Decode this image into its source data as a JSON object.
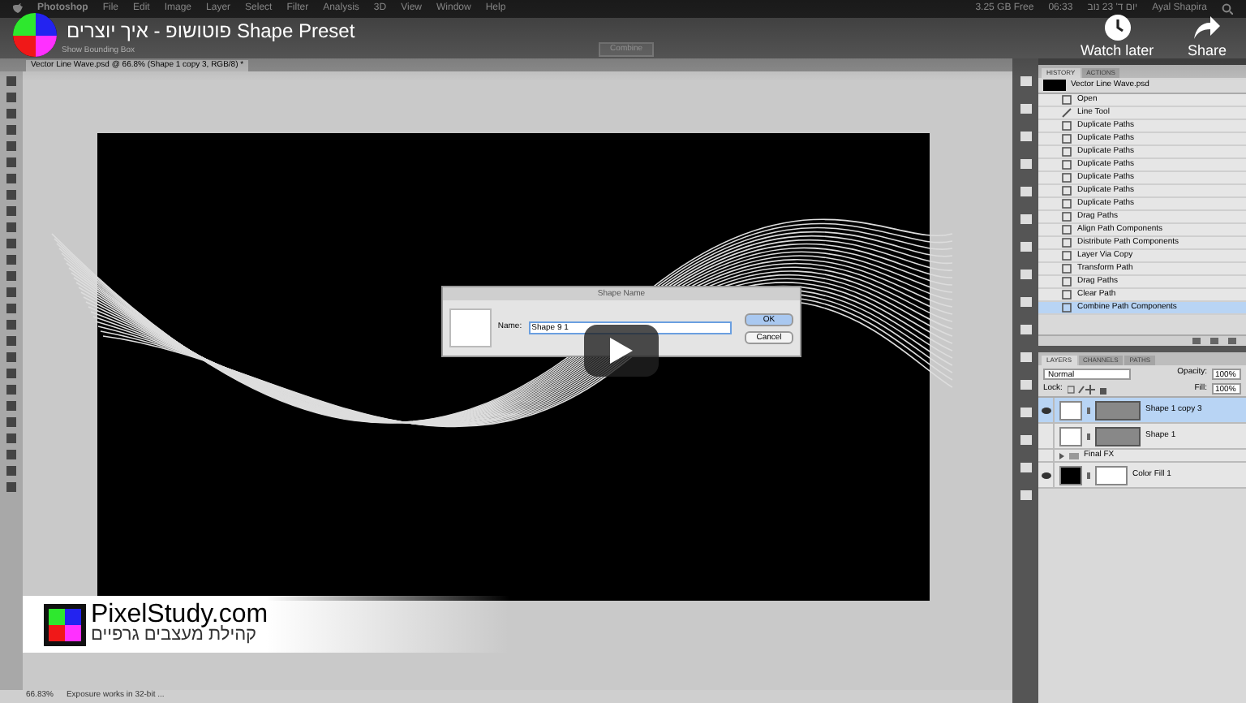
{
  "player": {
    "title": "פוטושופ - איך יוצרים Shape Preset",
    "watch_later_label": "Watch later",
    "share_label": "Share"
  },
  "menu_bar": {
    "app": "Photoshop",
    "items": [
      "File",
      "Edit",
      "Image",
      "Layer",
      "Select",
      "Filter",
      "Analysis",
      "3D",
      "View",
      "Window",
      "Help"
    ],
    "status": [
      "3.25 GB Free",
      "06:33",
      "יום ד' 23 נוב",
      "Ayal Shapira"
    ]
  },
  "options_bar": {
    "items": [
      "Show Bounding Box",
      "Combine"
    ]
  },
  "document_tab": {
    "title": "Vector Line Wave.psd @ 66.8% (Shape 1 copy 3, RGB/8) *"
  },
  "dialog": {
    "title": "Shape Name",
    "name_label": "Name:",
    "name_value": "Shape 9 1",
    "buttons": [
      {
        "label": "OK",
        "default": true
      },
      {
        "label": "Cancel",
        "default": false
      }
    ]
  },
  "history": {
    "tabs": [
      {
        "label": "HISTORY",
        "selected": true
      },
      {
        "label": "ACTIONS",
        "selected": false
      }
    ],
    "snapshot": "Vector Line Wave.psd",
    "items": [
      {
        "label": "Open",
        "kind": "document",
        "selected": false
      },
      {
        "label": "Line Tool",
        "kind": "line",
        "selected": false
      },
      {
        "label": "Duplicate Paths",
        "kind": "document",
        "selected": false
      },
      {
        "label": "Duplicate Paths",
        "kind": "document",
        "selected": false
      },
      {
        "label": "Duplicate Paths",
        "kind": "document",
        "selected": false
      },
      {
        "label": "Duplicate Paths",
        "kind": "document",
        "selected": false
      },
      {
        "label": "Duplicate Paths",
        "kind": "document",
        "selected": false
      },
      {
        "label": "Duplicate Paths",
        "kind": "document",
        "selected": false
      },
      {
        "label": "Duplicate Paths",
        "kind": "document",
        "selected": false
      },
      {
        "label": "Drag Paths",
        "kind": "document",
        "selected": false
      },
      {
        "label": "Align Path Components",
        "kind": "document",
        "selected": false
      },
      {
        "label": "Distribute Path Components",
        "kind": "document",
        "selected": false
      },
      {
        "label": "Layer Via Copy",
        "kind": "document",
        "selected": false
      },
      {
        "label": "Transform Path",
        "kind": "document",
        "selected": false
      },
      {
        "label": "Drag Paths",
        "kind": "document",
        "selected": false
      },
      {
        "label": "Clear Path",
        "kind": "document",
        "selected": false
      },
      {
        "label": "Combine Path Components",
        "kind": "document",
        "selected": true
      }
    ]
  },
  "layers": {
    "tabs": [
      {
        "label": "LAYERS",
        "selected": true
      },
      {
        "label": "CHANNELS",
        "selected": false
      },
      {
        "label": "PATHS",
        "selected": false
      }
    ],
    "blend_mode": "Normal",
    "opacity_label": "Opacity:",
    "opacity": "100%",
    "lock_label": "Lock:",
    "fill_label": "Fill:",
    "fill": "100%",
    "layers": [
      {
        "name": "Shape 1 copy 3",
        "kind": "shape",
        "visible": true,
        "selected": true
      },
      {
        "name": "Shape 1",
        "kind": "shape",
        "visible": false,
        "selected": false
      },
      {
        "name": "Final FX",
        "kind": "group",
        "visible": false,
        "selected": false
      },
      {
        "name": "Color Fill 1",
        "kind": "fill",
        "visible": true,
        "selected": false
      }
    ]
  },
  "status_bar": {
    "zoom": "66.83%",
    "info": "Exposure works in 32-bit ..."
  },
  "logo": {
    "name": "PixelStudy.com",
    "tagline": "קהילת מעצבים גרפיים"
  }
}
